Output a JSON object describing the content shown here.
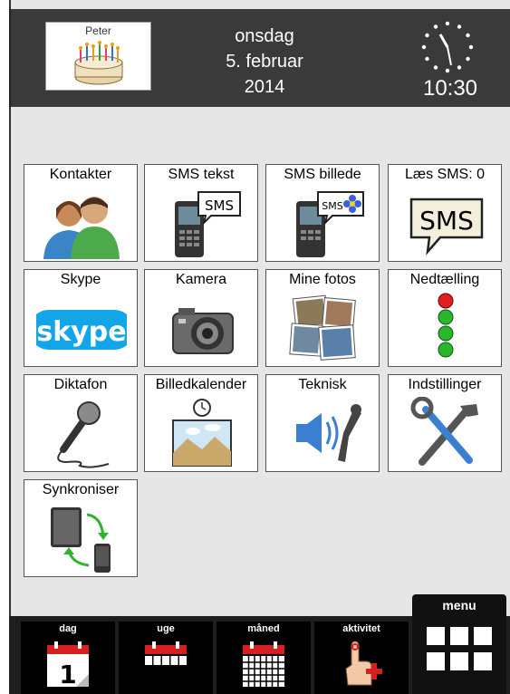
{
  "header": {
    "profile_name": "Peter",
    "weekday": "onsdag",
    "date": "5. februar",
    "year": "2014",
    "time": "10:30"
  },
  "apps": [
    {
      "label": "Kontakter",
      "icon": "contacts-icon"
    },
    {
      "label": "SMS tekst",
      "icon": "sms-text-icon"
    },
    {
      "label": "SMS billede",
      "icon": "sms-picture-icon"
    },
    {
      "label": "Læs SMS: 0",
      "icon": "read-sms-icon"
    },
    {
      "label": "Skype",
      "icon": "skype-icon"
    },
    {
      "label": "Kamera",
      "icon": "camera-icon"
    },
    {
      "label": "Mine fotos",
      "icon": "photos-icon"
    },
    {
      "label": "Nedtælling",
      "icon": "countdown-icon"
    },
    {
      "label": "Diktafon",
      "icon": "microphone-icon"
    },
    {
      "label": "Billedkalender",
      "icon": "picture-calendar-icon"
    },
    {
      "label": "Teknisk",
      "icon": "speaker-wrench-icon"
    },
    {
      "label": "Indstillinger",
      "icon": "tools-icon"
    },
    {
      "label": "Synkroniser",
      "icon": "sync-icon"
    }
  ],
  "bottom_nav": {
    "items": [
      {
        "label": "dag",
        "icon": "calendar-day-icon"
      },
      {
        "label": "uge",
        "icon": "calendar-week-icon"
      },
      {
        "label": "måned",
        "icon": "calendar-month-icon"
      },
      {
        "label": "aktivitet",
        "icon": "add-activity-icon"
      }
    ],
    "menu_label": "menu"
  },
  "colors": {
    "header_bg": "#3a3a3a",
    "content_bg": "#e6e6e6",
    "calendar_red": "#d42020",
    "traffic_red": "#e02020",
    "traffic_green": "#2db52d"
  }
}
